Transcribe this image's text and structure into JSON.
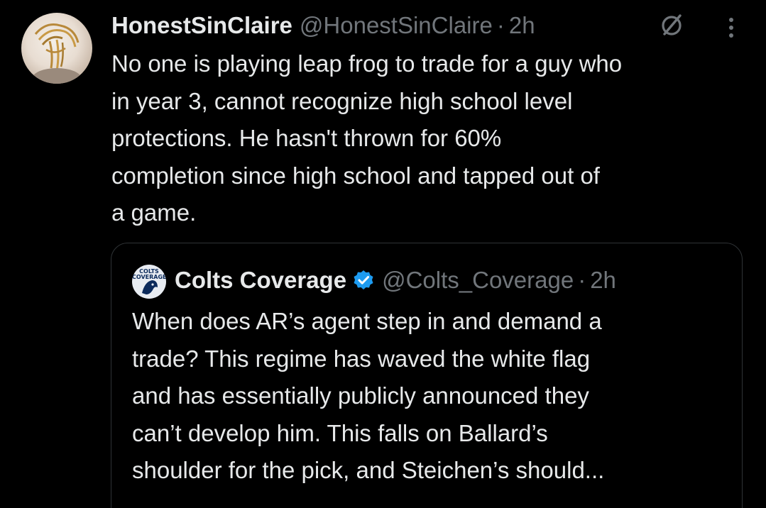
{
  "tweet": {
    "display_name": "HonestSinClaire",
    "handle": "@HonestSinClaire",
    "separator": "·",
    "time": "2h",
    "text": "No one is playing leap frog to trade for a guy who\nin year 3, cannot recognize high school level\nprotections. He hasn't thrown for 60%\ncompletion since high school and tapped out of\na game.",
    "icons": {
      "grok": "grok-slash-icon",
      "more": "more-vertical-icon"
    }
  },
  "quoted_tweet": {
    "avatar_text": "COLTS COVERAGE",
    "display_name": "Colts Coverage",
    "handle": "@Colts_Coverage",
    "separator": "·",
    "time": "2h",
    "verified_icon": "verified-badge-icon",
    "verified_color": "#1d9bf0",
    "text": "When does AR’s agent step in and demand a\ntrade? This regime has waved the white flag\nand has essentially publicly announced they\ncan’t develop him. This falls on Ballard’s\nshoulder for the pick, and Steichen’s should..."
  },
  "colors": {
    "background": "#000000",
    "primary_text": "#e7e9ea",
    "secondary_text": "#71767b",
    "border": "#2f3336"
  }
}
